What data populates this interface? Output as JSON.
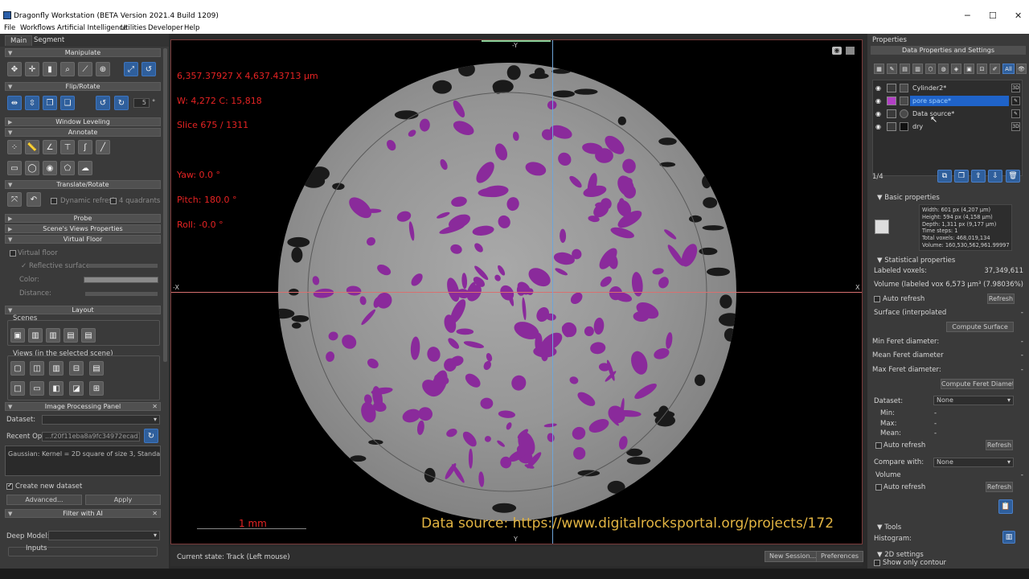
{
  "window": {
    "title": "Dragonfly Workstation (BETA Version 2021.4 Build 1209)",
    "min": "─",
    "max": "☐",
    "close": "✕"
  },
  "menu": [
    "File",
    "Workflows",
    "Artificial Intelligence",
    "Utilities",
    "Developer",
    "Help"
  ],
  "left": {
    "tabs": [
      "Main",
      "Segment"
    ],
    "sections": {
      "manipulate": "Manipulate",
      "flip_rotate": "Flip/Rotate",
      "window_leveling": "Window Leveling",
      "annotate": "Annotate",
      "translate_rotate": "Translate/Rotate",
      "probe": "Probe",
      "scene_views": "Scene's Views Properties",
      "virtual_floor": "Virtual Floor",
      "layout": "Layout",
      "image_processing": "Image Processing Panel",
      "filter_ai": "Filter with AI"
    },
    "rotate_step": "5",
    "rotate_unit": "°",
    "dynamic_refresh": "Dynamic refresh",
    "four_quadrants": "4 quadrants",
    "virtual_floor_label": "Virtual floor",
    "reflective_surface": "Reflective surface",
    "color_label": "Color:",
    "distance_label": "Distance:",
    "scenes_label": "Scenes",
    "views_label": "Views (in the selected scene)",
    "dataset_label": "Dataset:",
    "recent_op_label": "Recent Op",
    "recent_op_value": "...f20f11eba8a9fc34972ecad1",
    "gaussian_text": "Gaussian: Kernel = 2D square of size 3, Standard deviation",
    "create_new_dataset": "Create new dataset",
    "advanced_btn": "Advanced...",
    "apply_btn": "Apply",
    "deep_model_label": "Deep Model:",
    "inputs_label": "Inputs"
  },
  "viewport": {
    "coords": "6,357.37927 X 4,637.43713 µm",
    "wl": "W: 4,272 C: 15,818",
    "slice": "Slice 675 / 1311",
    "yaw": "Yaw: 0.0 °",
    "pitch": "Pitch: 180.0 °",
    "roll": "Roll: -0.0 °",
    "axis_top": "-Y",
    "axis_bottom": "Y",
    "axis_left": "-X",
    "axis_right": "X",
    "scale": "1 mm",
    "data_source": "Data source: https://www.digitalrocksportal.org/projects/172",
    "colors": {
      "pore": "#8a2a9b",
      "overlay_text": "#e62323",
      "source_text": "#e2b442"
    }
  },
  "status": {
    "current": "Current state: Track (Left mouse)",
    "new_session": "New Session...",
    "preferences": "Preferences"
  },
  "right": {
    "header": "Properties",
    "sub": "Data Properties and Settings",
    "all_label": "All",
    "objects": [
      {
        "name": "Cylinder2*",
        "tag": "3D",
        "swatch": "#3a3a3a"
      },
      {
        "name": "pore space*",
        "tag": "✎",
        "swatch": "#b23fc4"
      },
      {
        "name": "Data source*",
        "tag": "✎",
        "swatch": "#3a3a3a"
      },
      {
        "name": "dry",
        "tag": "3D",
        "swatch": "#3a3a3a"
      }
    ],
    "count": "1/4",
    "basic_title": "Basic properties",
    "basic_lines": [
      "Width: 601 px (4,207 µm)",
      "Height: 594 px (4,158 µm)",
      "Depth: 1,311 px (9,177 µm)",
      "Time steps: 1",
      "Total voxels: 468,019,134",
      "Volume: 160,530,562,961.99997"
    ],
    "stat_title": "Statistical properties",
    "labeled_voxels_label": "Labeled voxels:",
    "labeled_voxels_value": "37,349,611",
    "volume_label": "Volume (labeled vox",
    "volume_value": "6,573 µm³ (7.98036%)",
    "auto_refresh": "Auto refresh",
    "refresh": "Refresh",
    "surface_label": "Surface (interpolated",
    "surface_value": "-",
    "compute_surface": "Compute Surface",
    "min_feret": "Min Feret diameter:",
    "mean_feret": "Mean Feret diameter",
    "max_feret": "Max Feret diameter:",
    "dash": "-",
    "compute_feret": "Compute Feret Diamete",
    "dataset_label": "Dataset:",
    "dataset_value": "None",
    "min_label": "Min:",
    "max_label": "Max:",
    "mean_label": "Mean:",
    "compare_label": "Compare with:",
    "compare_value": "None",
    "compare_volume": "Volume",
    "tools_title": "Tools",
    "histogram_label": "Histogram:",
    "settings_2d": "2D settings",
    "show_only_contour": "Show only contour"
  }
}
